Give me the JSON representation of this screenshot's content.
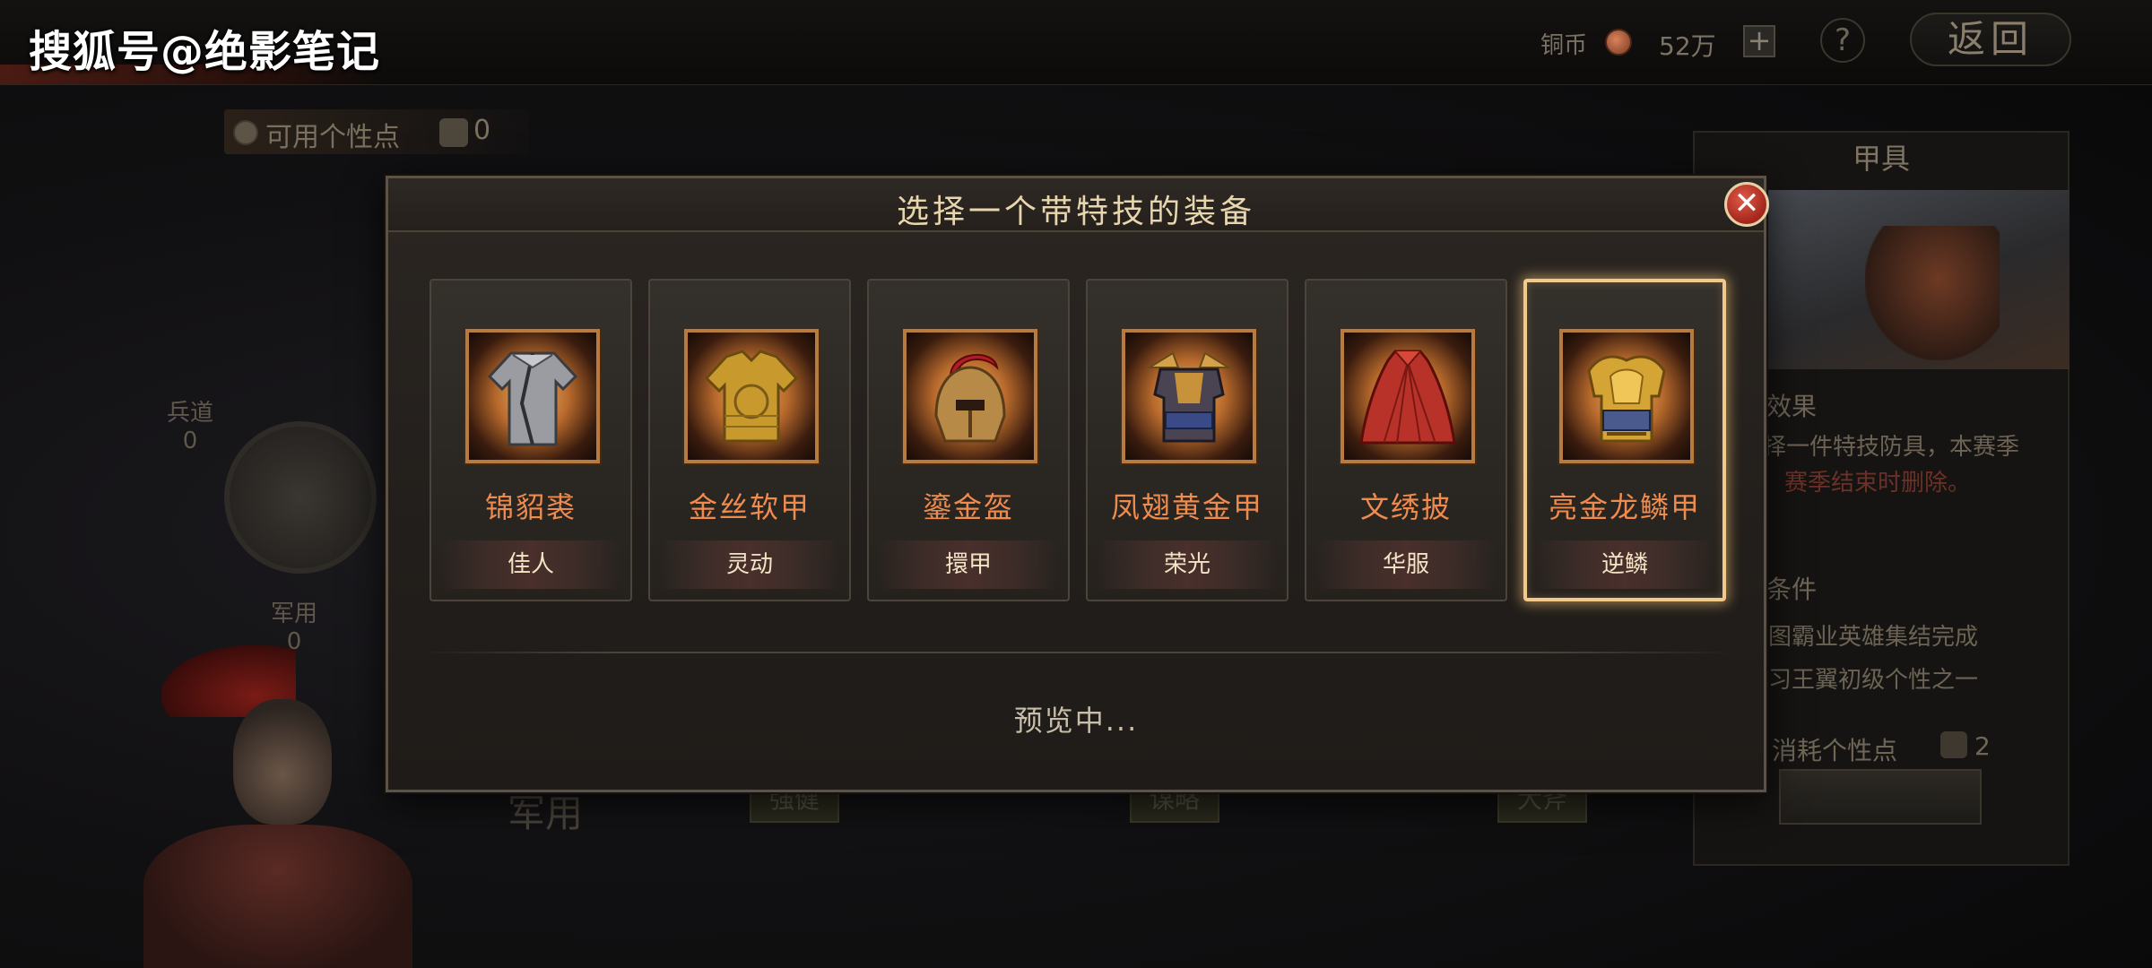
{
  "watermark": "搜狐号@绝影笔记",
  "header": {
    "coin_label": "铜币",
    "coin_amount": "52万",
    "plus_label": "+",
    "help_label": "?",
    "back_label": "返回"
  },
  "personality": {
    "label": "可用个性点",
    "value": "0"
  },
  "background": {
    "stats": [
      {
        "label": "兵道",
        "value": "0"
      },
      {
        "label": "军用",
        "value": "0"
      }
    ],
    "section_label": "军用",
    "tags": [
      "强健",
      "谋略",
      "大斧"
    ]
  },
  "side_panel": {
    "title": "甲具",
    "effect_heading": "效果",
    "effect_line1": "择一件特技防具，本赛季",
    "effect_line2": "赛季结束时删除。",
    "condition_heading": "条件",
    "condition_line1": "图霸业英雄集结完成",
    "condition_line2": "习王翼初级个性之一",
    "cost_label": "消耗个性点",
    "cost_value": "2"
  },
  "dialog": {
    "title": "选择一个带特技的装备",
    "close_label": "✕",
    "preview_text": "预览中...",
    "selected_index": 5,
    "items": [
      {
        "name": "锦貂裘",
        "skill": "佳人",
        "icon": "robe-icon"
      },
      {
        "name": "金丝软甲",
        "skill": "灵动",
        "icon": "gold-vest-icon"
      },
      {
        "name": "鎏金盔",
        "skill": "擐甲",
        "icon": "helmet-icon"
      },
      {
        "name": "凤翅黄金甲",
        "skill": "荣光",
        "icon": "phoenix-armor-icon"
      },
      {
        "name": "文绣披",
        "skill": "华服",
        "icon": "cape-icon"
      },
      {
        "name": "亮金龙鳞甲",
        "skill": "逆鳞",
        "icon": "dragon-armor-icon"
      }
    ]
  }
}
